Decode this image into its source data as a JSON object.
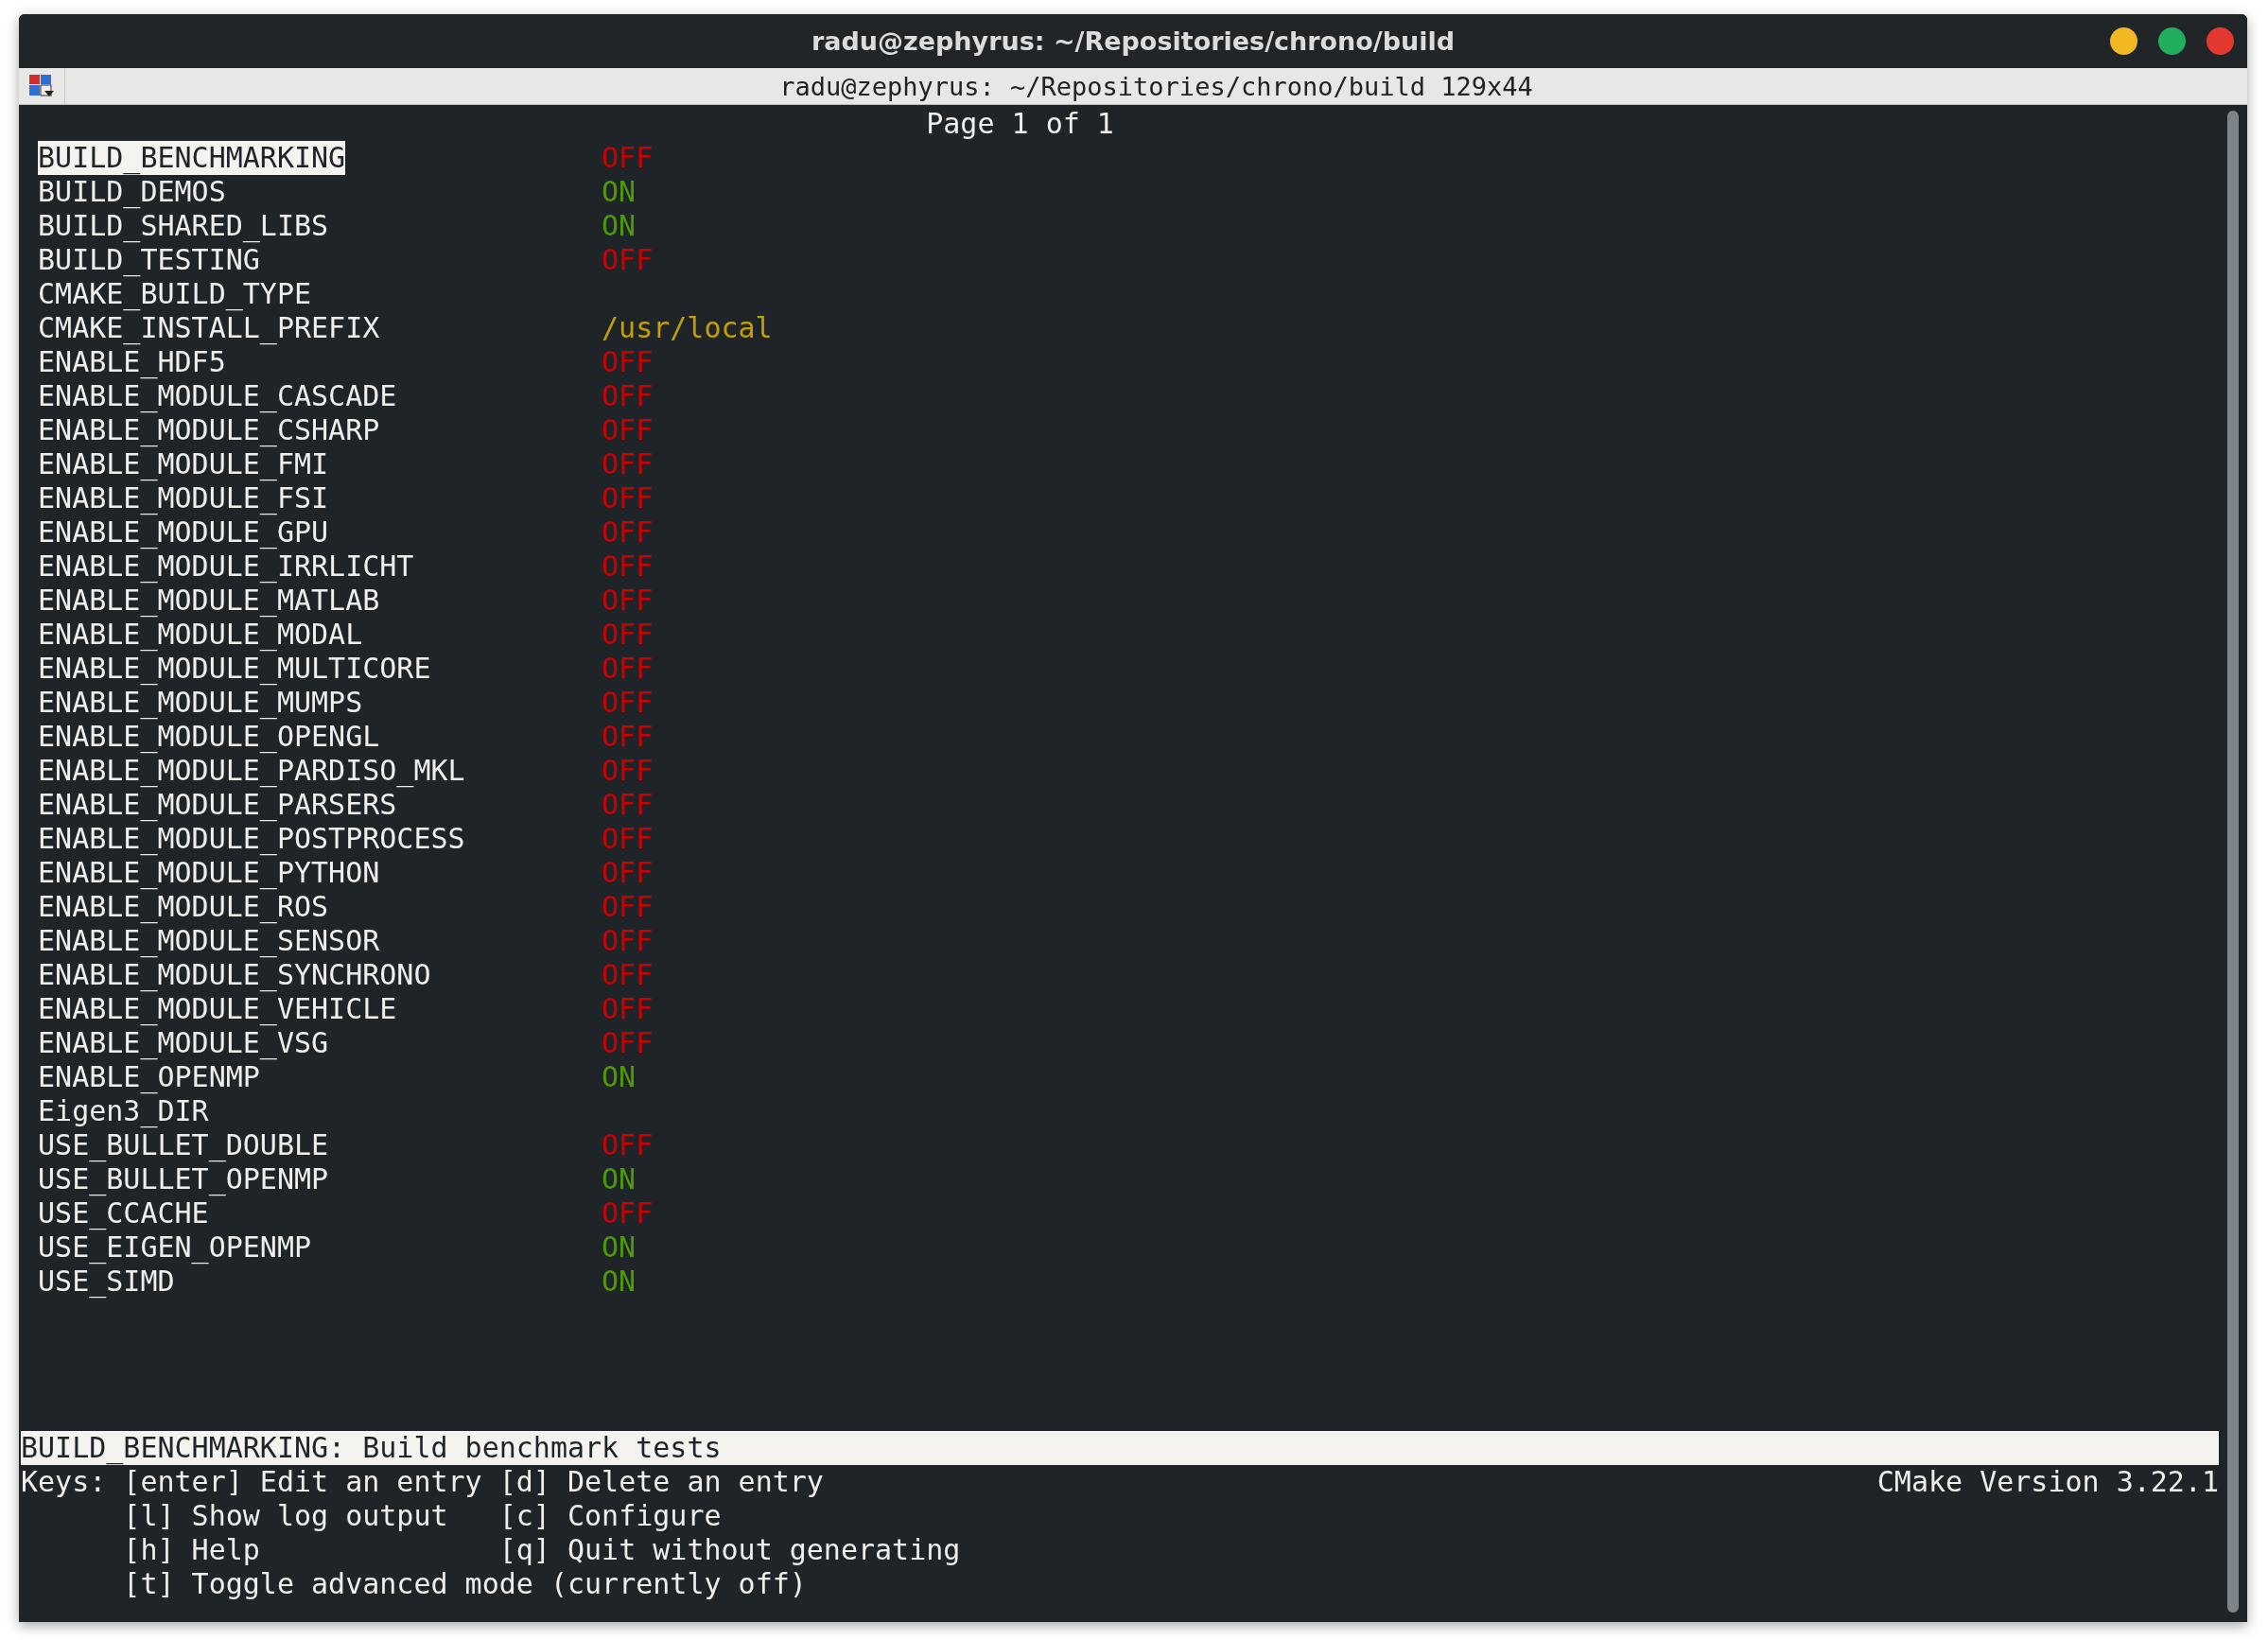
{
  "window": {
    "title": "radu@zephyrus: ~/Repositories/chrono/build"
  },
  "tab": {
    "title": "radu@zephyrus: ~/Repositories/chrono/build 129x44"
  },
  "page_indicator": "Page 1 of 1",
  "entries": [
    {
      "name": "BUILD_BENCHMARKING",
      "kind": "off",
      "value": "OFF",
      "selected": true
    },
    {
      "name": "BUILD_DEMOS",
      "kind": "on",
      "value": "ON",
      "selected": false
    },
    {
      "name": "BUILD_SHARED_LIBS",
      "kind": "on",
      "value": "ON",
      "selected": false
    },
    {
      "name": "BUILD_TESTING",
      "kind": "off",
      "value": "OFF",
      "selected": false
    },
    {
      "name": "CMAKE_BUILD_TYPE",
      "selected": false
    },
    {
      "name": "CMAKE_INSTALL_PREFIX",
      "kind": "path",
      "value": "/usr/local",
      "selected": false
    },
    {
      "name": "ENABLE_HDF5",
      "kind": "off",
      "value": "OFF",
      "selected": false
    },
    {
      "name": "ENABLE_MODULE_CASCADE",
      "kind": "off",
      "value": "OFF",
      "selected": false
    },
    {
      "name": "ENABLE_MODULE_CSHARP",
      "kind": "off",
      "value": "OFF",
      "selected": false
    },
    {
      "name": "ENABLE_MODULE_FMI",
      "kind": "off",
      "value": "OFF",
      "selected": false
    },
    {
      "name": "ENABLE_MODULE_FSI",
      "kind": "off",
      "value": "OFF",
      "selected": false
    },
    {
      "name": "ENABLE_MODULE_GPU",
      "kind": "off",
      "value": "OFF",
      "selected": false
    },
    {
      "name": "ENABLE_MODULE_IRRLICHT",
      "kind": "off",
      "value": "OFF",
      "selected": false
    },
    {
      "name": "ENABLE_MODULE_MATLAB",
      "kind": "off",
      "value": "OFF",
      "selected": false
    },
    {
      "name": "ENABLE_MODULE_MODAL",
      "kind": "off",
      "value": "OFF",
      "selected": false
    },
    {
      "name": "ENABLE_MODULE_MULTICORE",
      "kind": "off",
      "value": "OFF",
      "selected": false
    },
    {
      "name": "ENABLE_MODULE_MUMPS",
      "kind": "off",
      "value": "OFF",
      "selected": false
    },
    {
      "name": "ENABLE_MODULE_OPENGL",
      "kind": "off",
      "value": "OFF",
      "selected": false
    },
    {
      "name": "ENABLE_MODULE_PARDISO_MKL",
      "kind": "off",
      "value": "OFF",
      "selected": false
    },
    {
      "name": "ENABLE_MODULE_PARSERS",
      "kind": "off",
      "value": "OFF",
      "selected": false
    },
    {
      "name": "ENABLE_MODULE_POSTPROCESS",
      "kind": "off",
      "value": "OFF",
      "selected": false
    },
    {
      "name": "ENABLE_MODULE_PYTHON",
      "kind": "off",
      "value": "OFF",
      "selected": false
    },
    {
      "name": "ENABLE_MODULE_ROS",
      "kind": "off",
      "value": "OFF",
      "selected": false
    },
    {
      "name": "ENABLE_MODULE_SENSOR",
      "kind": "off",
      "value": "OFF",
      "selected": false
    },
    {
      "name": "ENABLE_MODULE_SYNCHRONO",
      "kind": "off",
      "value": "OFF",
      "selected": false
    },
    {
      "name": "ENABLE_MODULE_VEHICLE",
      "kind": "off",
      "value": "OFF",
      "selected": false
    },
    {
      "name": "ENABLE_MODULE_VSG",
      "kind": "off",
      "value": "OFF",
      "selected": false
    },
    {
      "name": "ENABLE_OPENMP",
      "kind": "on",
      "value": "ON",
      "selected": false
    },
    {
      "name": "Eigen3_DIR",
      "selected": false
    },
    {
      "name": "USE_BULLET_DOUBLE",
      "kind": "off",
      "value": "OFF",
      "selected": false
    },
    {
      "name": "USE_BULLET_OPENMP",
      "kind": "on",
      "value": "ON",
      "selected": false
    },
    {
      "name": "USE_CCACHE",
      "kind": "off",
      "value": "OFF",
      "selected": false
    },
    {
      "name": "USE_EIGEN_OPENMP",
      "kind": "on",
      "value": "ON",
      "selected": false
    },
    {
      "name": "USE_SIMD",
      "kind": "on",
      "value": "ON",
      "selected": false
    }
  ],
  "description": "BUILD_BENCHMARKING: Build benchmark tests",
  "keys_label": "Keys:",
  "keys": [
    "[enter] Edit an entry",
    "[d] Delete an entry",
    "[l] Show log output",
    "[c] Configure",
    "[h] Help",
    "[q] Quit without generating",
    "[t] Toggle advanced mode (currently off)"
  ],
  "version": "CMake Version 3.22.1"
}
